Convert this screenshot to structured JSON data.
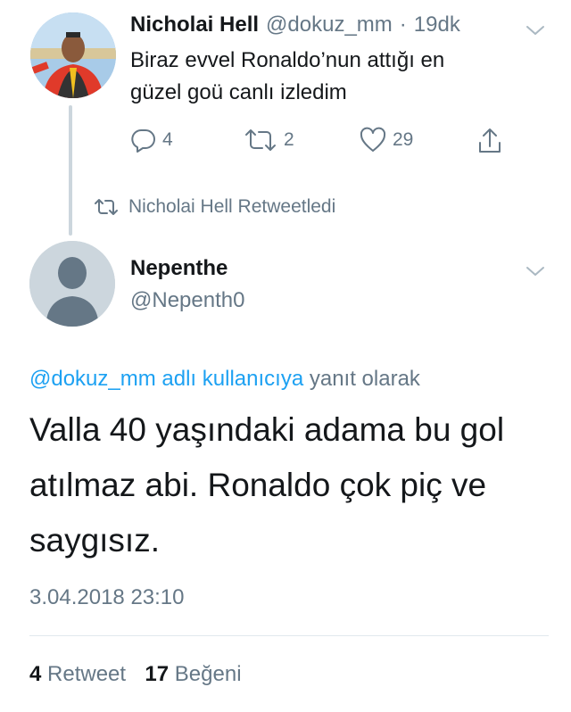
{
  "parent_tweet": {
    "display_name": "Nicholai Hell",
    "handle": "@dokuz_mm",
    "separator": "·",
    "age": "19dk",
    "text_line1": "Biraz evvel Ronaldo’nun attığı en",
    "text_line2": "güzel goü canlı izledim",
    "replies_count": "4",
    "retweets_count": "2",
    "likes_count": "29"
  },
  "retweet_context": {
    "label": "Nicholai Hell Retweetledi"
  },
  "main_tweet": {
    "display_name": "Nepenthe",
    "handle": "@Nepenth0",
    "reply_to_link": "@dokuz_mm adlı kullanıcıya",
    "reply_to_suffix": "yanıt olarak",
    "text_line1": "Valla 40 yaşındaki adama bu gol",
    "text_line2": "atılmaz abi. Ronaldo çok piç ve",
    "text_line3": "saygısız.",
    "timestamp": "3.04.2018 23:10",
    "retweet_count": "4",
    "retweet_label": "Retweet",
    "like_count": "17",
    "like_label": "Beğeni"
  },
  "colors": {
    "accent": "#1da1f2",
    "muted": "#657786",
    "text": "#14171a",
    "thread_line": "#ccd6dd"
  },
  "icons": {
    "reply": "reply-icon",
    "retweet": "retweet-icon",
    "like": "heart-icon",
    "share": "share-icon",
    "menu": "chevron-down-icon",
    "default_avatar": "default-avatar-icon"
  }
}
